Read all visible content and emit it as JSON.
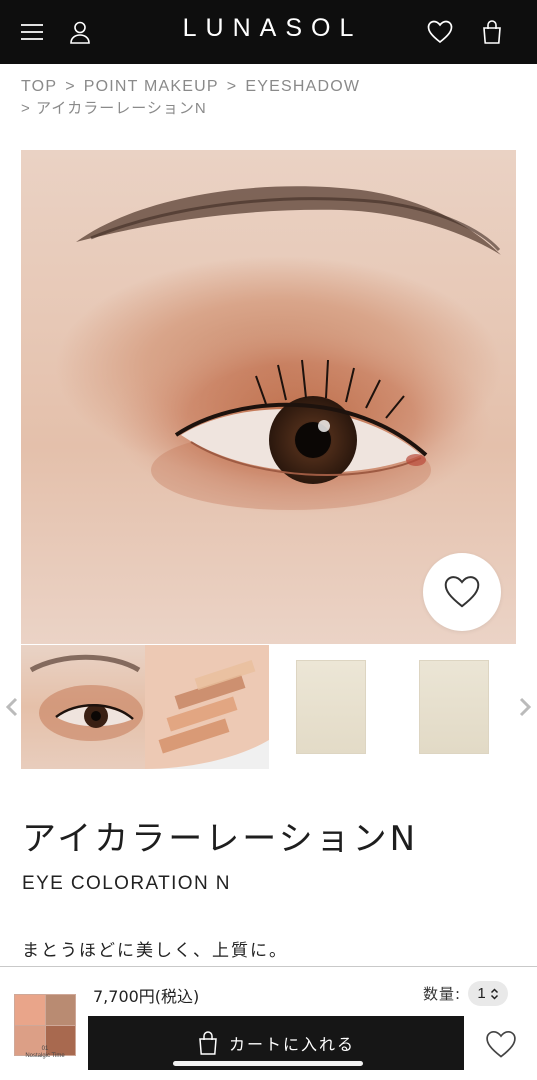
{
  "header": {
    "logo": "LUNASOL",
    "icons": [
      "menu-icon",
      "account-icon",
      "heart-icon",
      "cart-bag-icon"
    ]
  },
  "breadcrumb": {
    "items": [
      "TOP",
      "POINT MAKEUP",
      "EYESHADOW"
    ],
    "separator": ">",
    "current": "アイカラーレーションN"
  },
  "product": {
    "title_jp": "アイカラーレーションN",
    "title_en": "EYE COLORATION N",
    "catchphrase": "まとうほどに美しく、上質に。"
  },
  "purchase": {
    "price": "7,700円(税込)",
    "quantity_label": "数量:",
    "quantity_value": "1",
    "cart_button_label": "カートに入れる",
    "palette_caption_line1": "01",
    "palette_caption_line2": "Nostalgic Time",
    "palette_colors": [
      "#e9a58a",
      "#b98b72",
      "#dc9f86",
      "#a8694f"
    ]
  },
  "colors": {
    "header_bg": "#0e0e0e",
    "cart_button_bg": "#161616",
    "breadcrumb_text": "#8a8a8a"
  }
}
